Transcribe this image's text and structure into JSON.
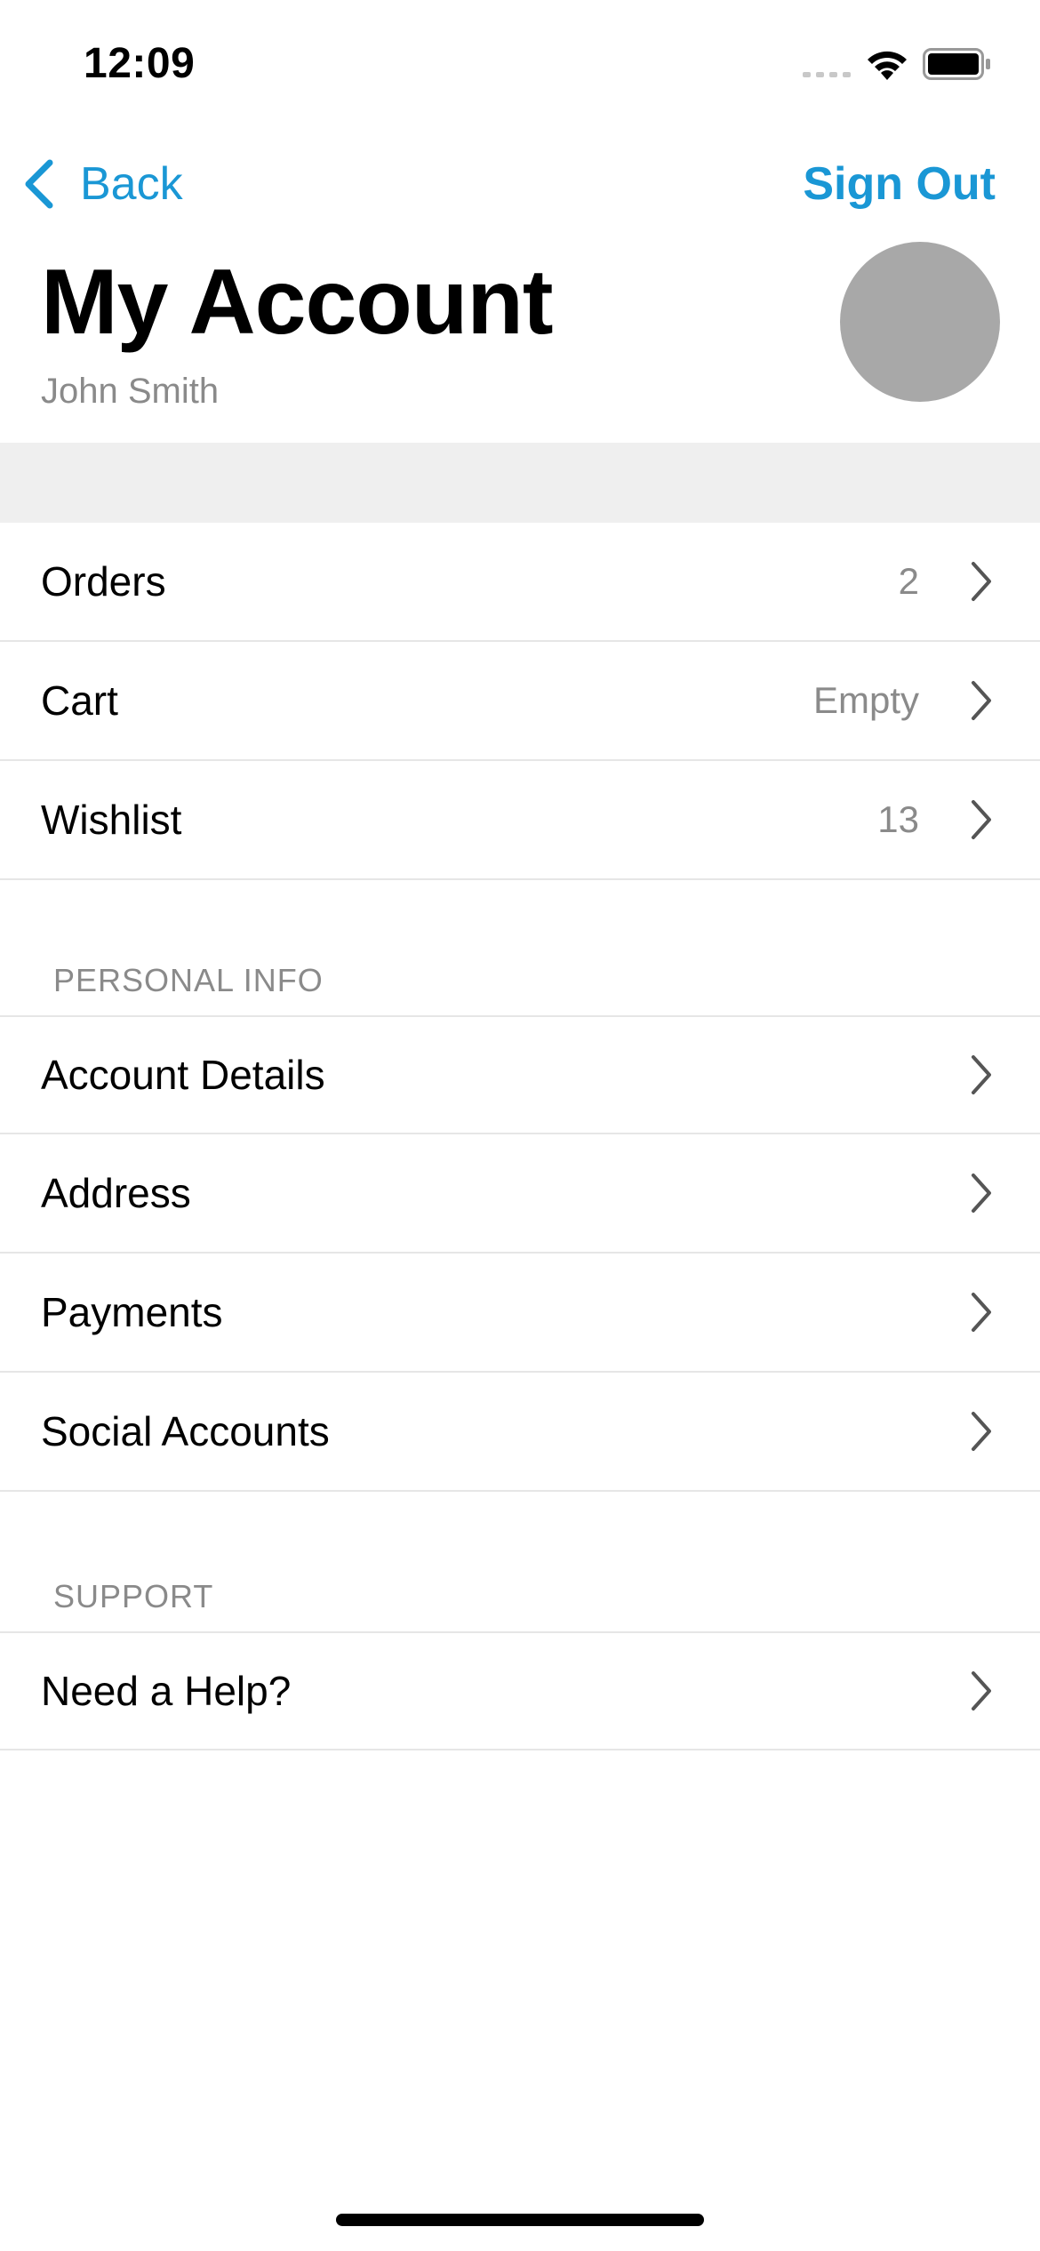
{
  "status_bar": {
    "time": "12:09"
  },
  "nav": {
    "back_label": "Back",
    "sign_out_label": "Sign Out"
  },
  "header": {
    "title": "My Account",
    "user_name": "John Smith"
  },
  "colors": {
    "accent": "#1a97d5",
    "secondary_text": "#8a8a8a",
    "avatar": "#a8a8a8",
    "separator": "#e6e6e6",
    "band": "#efefef"
  },
  "shopping": {
    "items": [
      {
        "label": "Orders",
        "value": "2"
      },
      {
        "label": "Cart",
        "value": "Empty"
      },
      {
        "label": "Wishlist",
        "value": "13"
      }
    ]
  },
  "personal_info": {
    "header": "PERSONAL INFO",
    "items": [
      {
        "label": "Account Details"
      },
      {
        "label": "Address"
      },
      {
        "label": "Payments"
      },
      {
        "label": "Social Accounts"
      }
    ]
  },
  "support": {
    "header": "SUPPORT",
    "items": [
      {
        "label": "Need a Help?"
      }
    ]
  },
  "icons": {
    "row_disclosure": "chevron-right-icon",
    "back": "chevron-left-icon",
    "signal": "cellular-signal-icon",
    "wifi": "wifi-icon",
    "battery": "battery-icon"
  }
}
